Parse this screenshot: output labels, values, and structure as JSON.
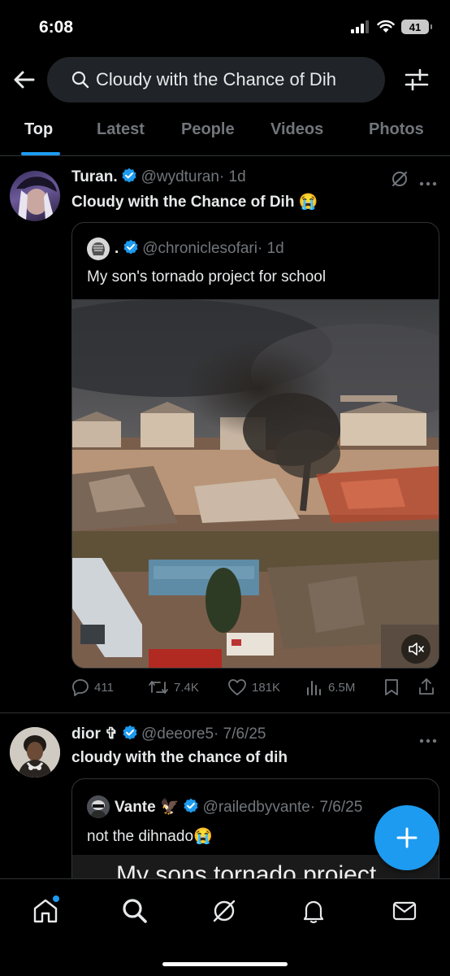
{
  "status": {
    "time": "6:08",
    "battery": "41"
  },
  "search": {
    "query": "Cloudy with the Chance of Dih"
  },
  "tabs": [
    "Top",
    "Latest",
    "People",
    "Videos",
    "Photos"
  ],
  "active_tab": "Top",
  "tweets": [
    {
      "name": "Turan.",
      "handle": "@wydturan",
      "time": "· 1d",
      "text": "Cloudy with the Chance of Dih 😭",
      "quote": {
        "name": ".",
        "handle": "@chroniclesofari",
        "time": "· 1d",
        "text": "My son's tornado project for school"
      },
      "metrics": {
        "replies": "411",
        "retweets": "7.4K",
        "likes": "181K",
        "views": "6.5M"
      }
    },
    {
      "name": "dior ✞",
      "handle": "@deeore5",
      "time": "· 7/6/25",
      "text": "cloudy with the chance of dih",
      "quote": {
        "name": "Vante 🦅",
        "handle": "@railedbyvante",
        "time": "· 7/6/25",
        "text": "not the dihnado😭",
        "media_caption": "My sons tornado project"
      }
    }
  ],
  "icons": {
    "back": "arrow-left-icon",
    "filter": "sliders-icon",
    "search": "search-icon",
    "grok": "grok-icon",
    "more": "more-icon",
    "verified": "verified-badge-icon",
    "mute": "mute-icon",
    "compose": "plus-icon",
    "nav": [
      "home-icon",
      "search-icon",
      "grok-icon",
      "bell-icon",
      "mail-icon"
    ]
  },
  "colors": {
    "accent": "#1d9bf0",
    "background": "#000000",
    "secondary_text": "#71767b"
  }
}
